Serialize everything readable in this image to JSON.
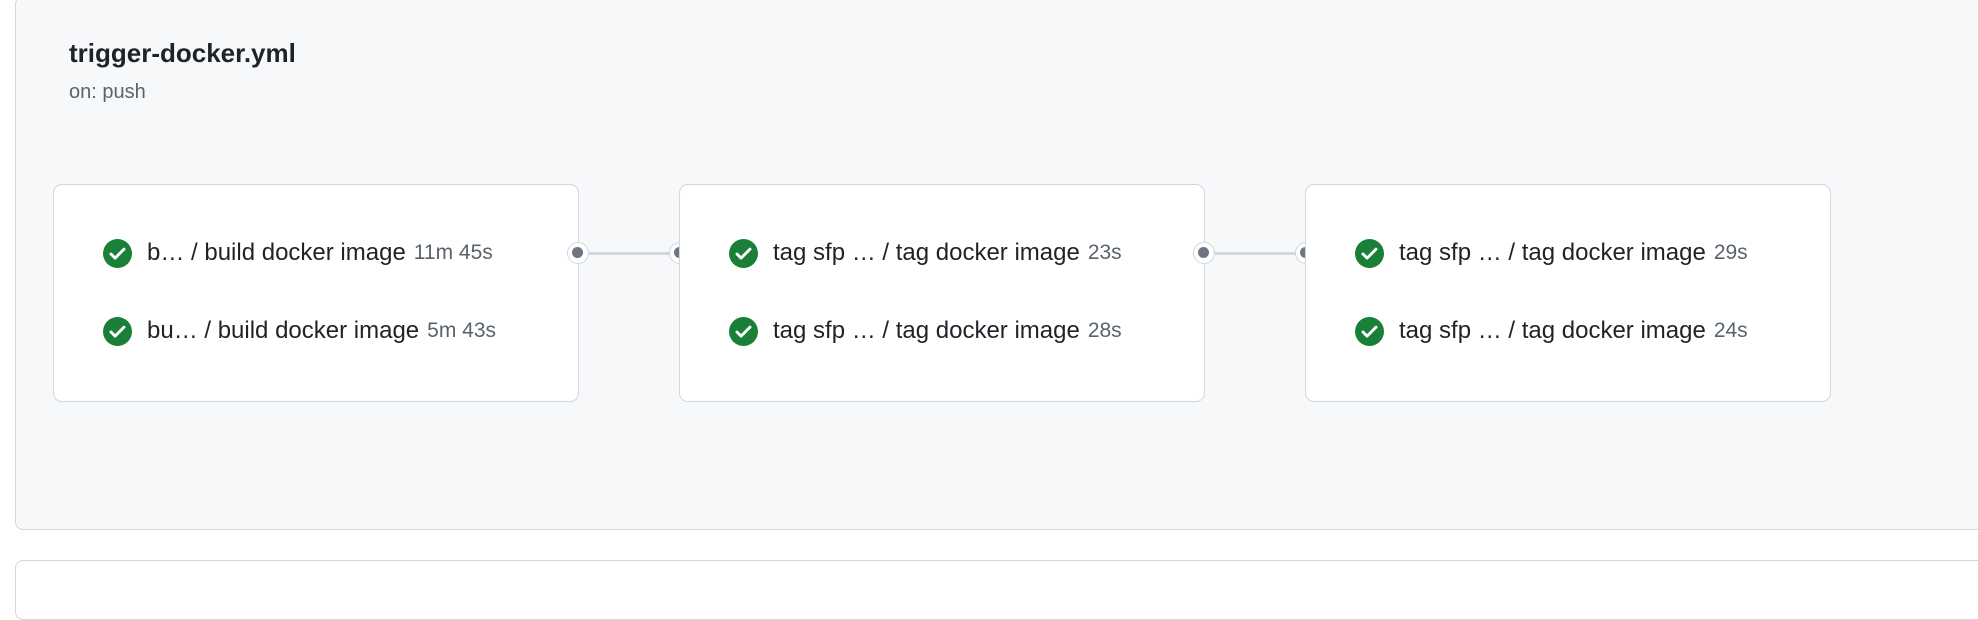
{
  "workflow": {
    "file_name": "trigger-docker.yml",
    "trigger": "on: push"
  },
  "colors": {
    "success": "#1a7f37",
    "panel_background": "#f6f8fa",
    "border": "#d0d7de",
    "node": "#6e7781"
  },
  "icons": {
    "job_status": "check-circle-fill-icon",
    "connector": "dot-icon"
  },
  "job_groups": [
    {
      "jobs": [
        {
          "name": "b…  / build docker image",
          "duration": "11m 45s",
          "status": "success"
        },
        {
          "name": "bu… / build docker image",
          "duration": "5m 43s",
          "status": "success"
        }
      ]
    },
    {
      "jobs": [
        {
          "name": "tag sfp … / tag docker image",
          "duration": "23s",
          "status": "success"
        },
        {
          "name": "tag sfp … / tag docker image",
          "duration": "28s",
          "status": "success"
        }
      ]
    },
    {
      "jobs": [
        {
          "name": "tag sfp … / tag docker image",
          "duration": "29s",
          "status": "success"
        },
        {
          "name": "tag sfp … / tag docker image",
          "duration": "24s",
          "status": "success"
        }
      ]
    }
  ]
}
